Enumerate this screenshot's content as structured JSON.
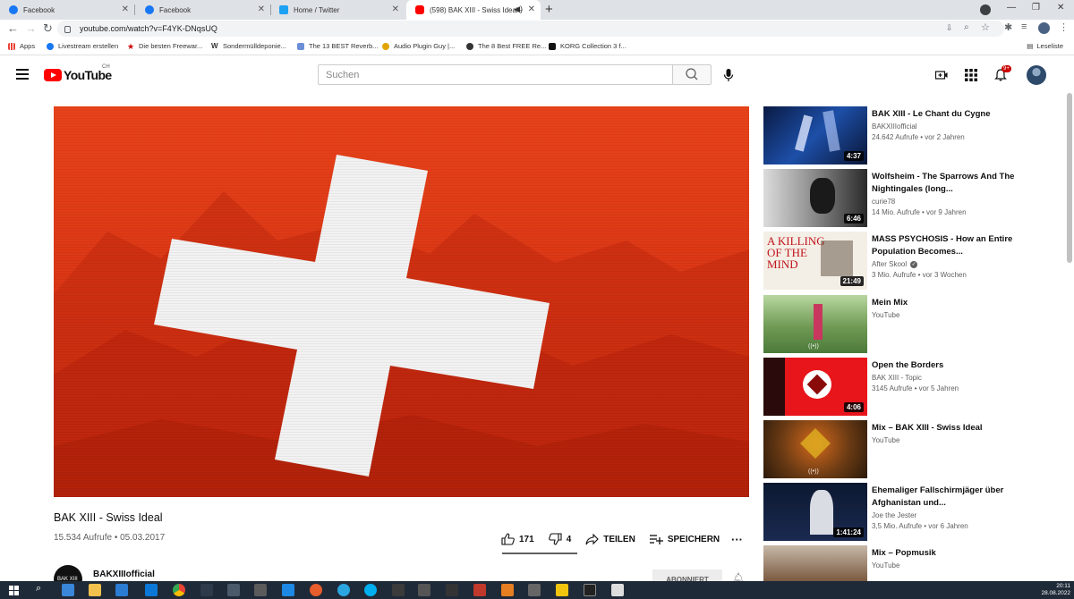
{
  "browser": {
    "tabs": [
      {
        "title": "Facebook",
        "icon": "facebook-icon",
        "color": "#1877f2"
      },
      {
        "title": "Facebook",
        "icon": "facebook-icon",
        "color": "#1877f2"
      },
      {
        "title": "Home / Twitter",
        "icon": "twitter-icon",
        "color": "#1da1f2"
      },
      {
        "title": "(598) BAK XIII - Swiss Ideal -",
        "icon": "youtube-icon",
        "color": "#ff0000",
        "active": true
      }
    ],
    "url": "youtube.com/watch?v=F4YK-DNqsUQ",
    "bookmarks": [
      {
        "label": "Apps",
        "icon": "apps-grid-icon"
      },
      {
        "label": "Livestream erstellen",
        "icon": "facebook-icon"
      },
      {
        "label": "Die besten Freewar...",
        "icon": "star-icon"
      },
      {
        "label": "Sondermülldeponie...",
        "icon": "w-icon"
      },
      {
        "label": "The 13 BEST Reverb...",
        "icon": "bookmark-icon"
      },
      {
        "label": "Audio Plugin Guy |...",
        "icon": "bookmark-icon"
      },
      {
        "label": "The 8 Best FREE Re...",
        "icon": "bookmark-icon"
      },
      {
        "label": "KORG Collection 3 f...",
        "icon": "korg-icon"
      }
    ],
    "reading_list": "Leseliste"
  },
  "youtube": {
    "logo_text": "YouTube",
    "country_code": "CH",
    "search_placeholder": "Suchen",
    "notification_count": "9+",
    "accent": "#ff0000"
  },
  "video": {
    "title": "BAK XIII - Swiss Ideal",
    "meta": "15.534 Aufrufe • 05.03.2017",
    "likes": "171",
    "dislikes": "4",
    "share_label": "TEILEN",
    "save_label": "SPEICHERN",
    "channel": "BAKXIIIofficial",
    "channel_avatar_text": "BAK XIII",
    "subscribe_label": "ABONNIERT"
  },
  "recommendations": [
    {
      "title": "BAK XIII - Le Chant du Cygne",
      "channel": "BAKXIIIofficial",
      "views": "24.642 Aufrufe • vor 2 Jahren",
      "duration": "4:37"
    },
    {
      "title": "Wolfsheim - The Sparrows And The Nightingales (long...",
      "channel": "curie78",
      "views": "14 Mio. Aufrufe • vor 9 Jahren",
      "duration": "6:46"
    },
    {
      "title": "MASS PSYCHOSIS - How an Entire Population Becomes...",
      "channel": "After Skool",
      "verified": true,
      "views": "3 Mio. Aufrufe • vor 3 Wochen",
      "duration": "21:49"
    },
    {
      "title": "Mein Mix",
      "channel": "YouTube",
      "views": "",
      "duration": ""
    },
    {
      "title": "Open the Borders",
      "channel": "BAK XIII - Topic",
      "views": "3145 Aufrufe • vor 5 Jahren",
      "duration": "4:06"
    },
    {
      "title": "Mix – BAK XIII - Swiss Ideal",
      "channel": "YouTube",
      "views": "",
      "duration": ""
    },
    {
      "title": "Ehemaliger Fallschirmjäger über Afghanistan und...",
      "channel": "Joe the Jester",
      "views": "3,5 Mio. Aufrufe • vor 6 Jahren",
      "duration": "1:41:24"
    },
    {
      "title": "Mix – Popmusik",
      "channel": "YouTube",
      "views": "",
      "duration": ""
    }
  ],
  "taskbar": {
    "time": "20:11",
    "date": "28.08.2022"
  }
}
